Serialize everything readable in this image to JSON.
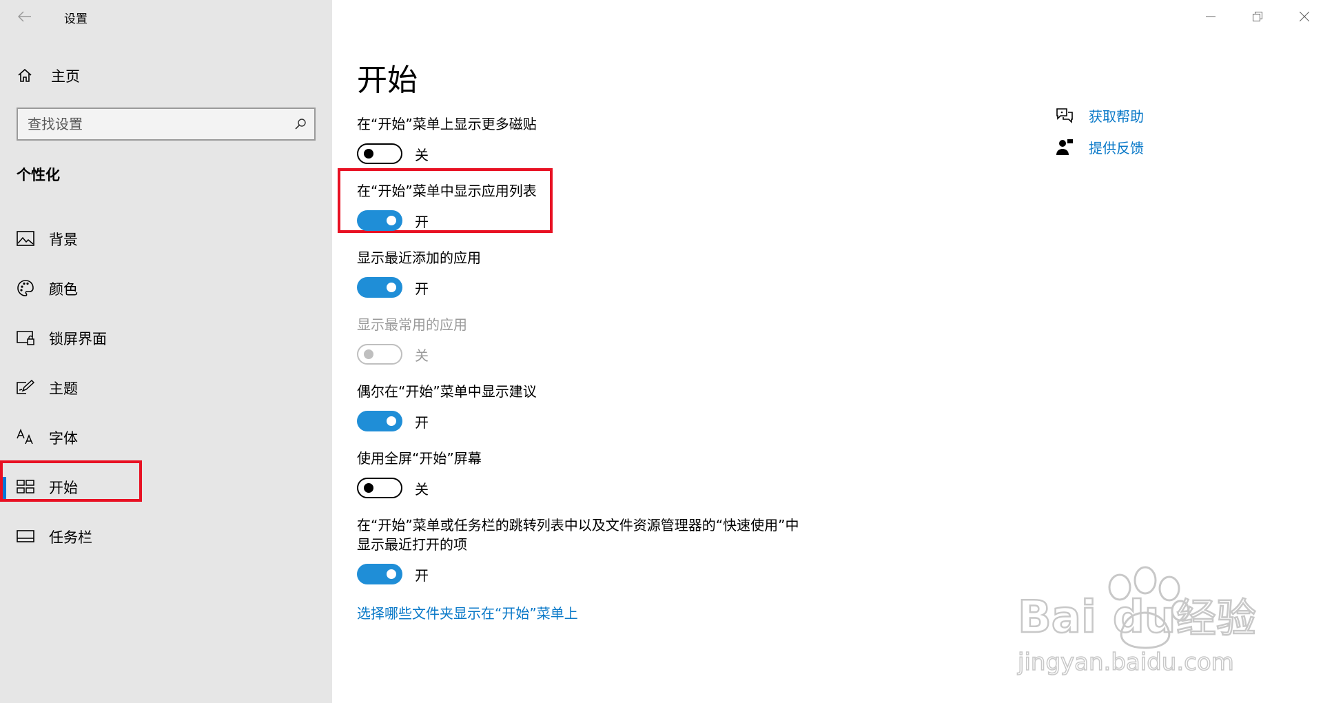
{
  "window": {
    "title": "设置",
    "controls": [
      "minimize",
      "restore",
      "close"
    ]
  },
  "sidebar": {
    "home_label": "主页",
    "search_placeholder": "查找设置",
    "section_heading": "个性化",
    "items": [
      {
        "label": "背景",
        "icon": "image-icon"
      },
      {
        "label": "颜色",
        "icon": "palette-icon"
      },
      {
        "label": "锁屏界面",
        "icon": "lock-screen-icon"
      },
      {
        "label": "主题",
        "icon": "theme-brush-icon"
      },
      {
        "label": "字体",
        "icon": "font-icon"
      },
      {
        "label": "开始",
        "icon": "start-tiles-icon",
        "selected": true
      },
      {
        "label": "任务栏",
        "icon": "taskbar-icon"
      }
    ]
  },
  "main": {
    "title": "开始",
    "settings": [
      {
        "label": "在“开始”菜单上显示更多磁贴",
        "state": "关",
        "on": false,
        "enabled": true
      },
      {
        "label": "在“开始”菜单中显示应用列表",
        "state": "开",
        "on": true,
        "enabled": true
      },
      {
        "label": "显示最近添加的应用",
        "state": "开",
        "on": true,
        "enabled": true
      },
      {
        "label": "显示最常用的应用",
        "state": "关",
        "on": false,
        "enabled": false
      },
      {
        "label": "偶尔在“开始”菜单中显示建议",
        "state": "开",
        "on": true,
        "enabled": true
      },
      {
        "label": "使用全屏“开始”屏幕",
        "state": "关",
        "on": false,
        "enabled": true
      },
      {
        "label": "在“开始”菜单或任务栏的跳转列表中以及文件资源管理器的“快速使用”中",
        "label2": "显示最近打开的项",
        "state": "开",
        "on": true,
        "enabled": true
      }
    ],
    "link": "选择哪些文件夹显示在“开始”菜单上"
  },
  "help": {
    "get_help": "获取帮助",
    "feedback": "提供反馈"
  },
  "watermark": {
    "brand": "Baidu",
    "brand_cn": "经验",
    "url": "jingyan.baidu.com"
  },
  "colors": {
    "accent": "#0078d7",
    "toggle_on": "#1f8ed7",
    "link": "#0a79c8",
    "highlight_box": "#e81123",
    "sidebar_bg": "#e6e6e6"
  }
}
